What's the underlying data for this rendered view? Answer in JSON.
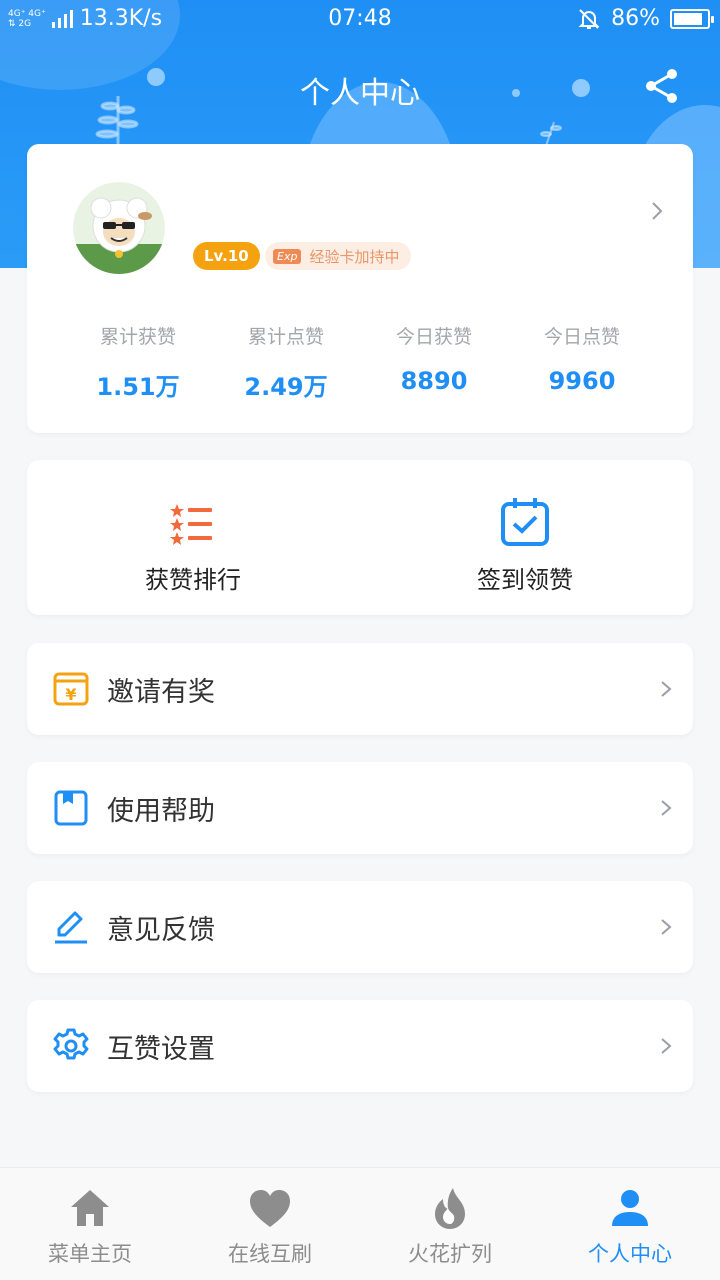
{
  "status_bar": {
    "network_top": "4G⁺ 4G⁺",
    "network_bottom": "⇅ 2G",
    "speed": "13.3K/s",
    "time": "07:48",
    "battery": "86%",
    "battery_level": 0.86
  },
  "header": {
    "title": "个人中心",
    "share_icon": "share-icon"
  },
  "profile": {
    "level": "Lv.10",
    "exp_tag": "Exp",
    "exp_text": "经验卡加持中",
    "stats": [
      {
        "label": "累计获赞",
        "value": "1.51万"
      },
      {
        "label": "累计点赞",
        "value": "2.49万"
      },
      {
        "label": "今日获赞",
        "value": "8890"
      },
      {
        "label": "今日点赞",
        "value": "9960"
      }
    ]
  },
  "quick_actions": [
    {
      "label": "获赞排行",
      "icon": "ranking-list-icon"
    },
    {
      "label": "签到领赞",
      "icon": "calendar-check-icon"
    }
  ],
  "menu": [
    {
      "label": "邀请有奖",
      "icon": "yuan-gift-icon"
    },
    {
      "label": "使用帮助",
      "icon": "book-icon"
    },
    {
      "label": "意见反馈",
      "icon": "edit-pencil-icon"
    },
    {
      "label": "互赞设置",
      "icon": "gear-icon"
    }
  ],
  "tabs": [
    {
      "label": "菜单主页",
      "icon": "home-icon",
      "active": false
    },
    {
      "label": "在线互刷",
      "icon": "heart-icon",
      "active": false
    },
    {
      "label": "火花扩列",
      "icon": "flame-icon",
      "active": false
    },
    {
      "label": "个人中心",
      "icon": "person-icon",
      "active": true
    }
  ],
  "colors": {
    "primary": "#1f8ff5",
    "level_badge": "#f5a210",
    "exp_badge_bg": "#fdeee4",
    "rank_icon": "#f06a3c",
    "invite_icon": "#f5a210"
  }
}
